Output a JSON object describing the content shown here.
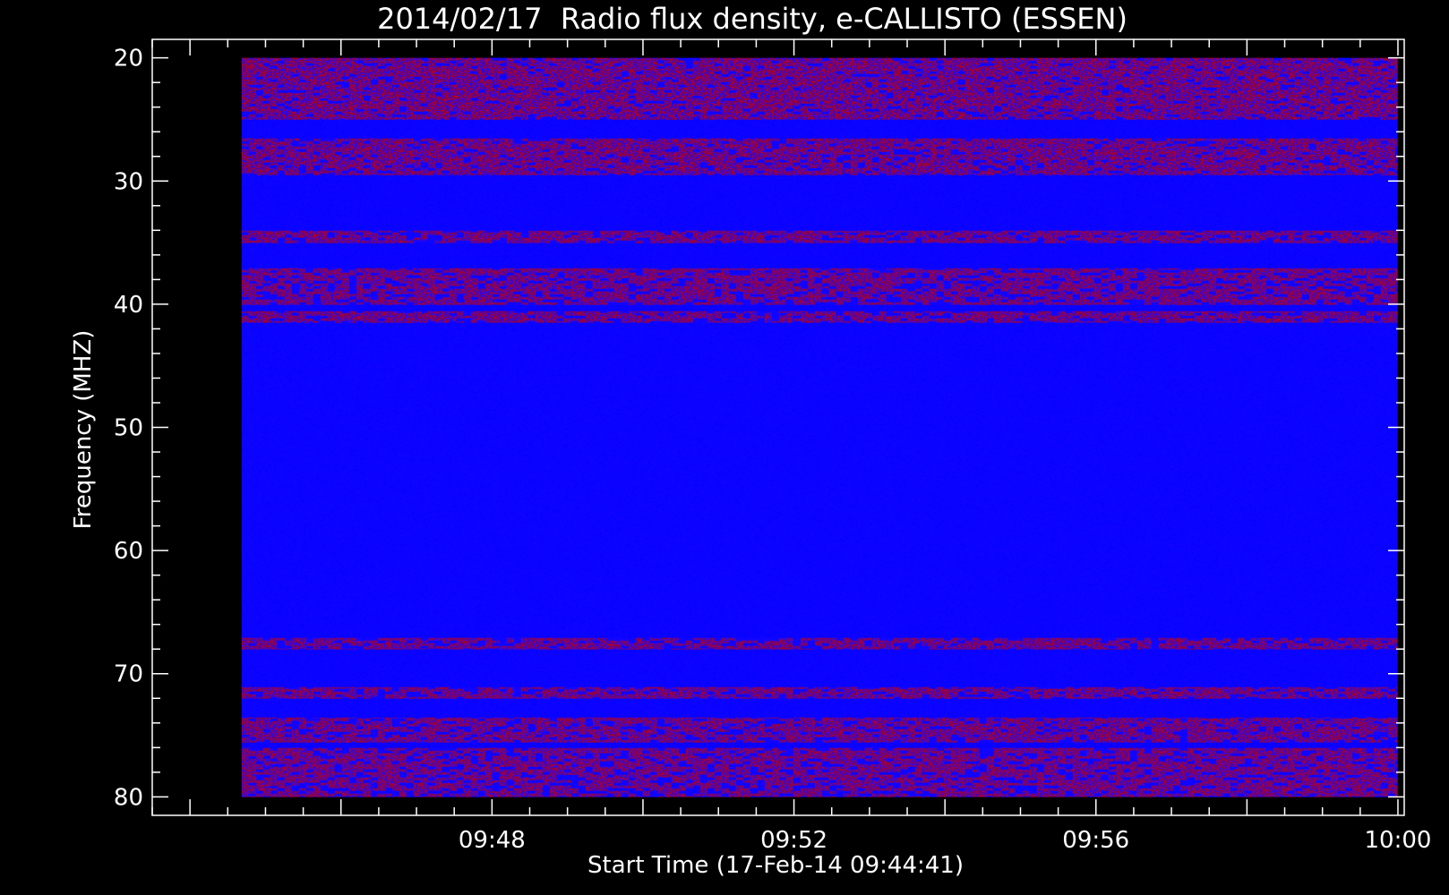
{
  "chart_data": {
    "type": "heatmap",
    "title": "2014/02/17  Radio flux density, e-CALLISTO (ESSEN)",
    "xlabel": "Start Time (17-Feb-14 09:44:41)",
    "ylabel": "Frequency (MHZ)",
    "x_unit": "UT time",
    "x_range": [
      "09:44:41",
      "10:00:00"
    ],
    "x_axis_range": [
      "09:43:30",
      "10:00:05"
    ],
    "x_ticks": [
      "09:48",
      "09:52",
      "09:56",
      "10:00"
    ],
    "y_unit": "MHz",
    "y_range": [
      20,
      80
    ],
    "y_axis_range": [
      18.5,
      81.5
    ],
    "y_inverted": true,
    "y_ticks": [
      20,
      30,
      40,
      50,
      60,
      70,
      80
    ],
    "colormap": [
      "#000000",
      "#0000ff",
      "#b00000",
      "#ff4000",
      "#ffd000",
      "#ffffff"
    ],
    "background_level": "blue",
    "emission_bands": [
      {
        "freq_range": [
          20,
          25
        ],
        "level": "high",
        "color": "red/yellow with dark gaps"
      },
      {
        "freq_range": [
          26.5,
          29.5
        ],
        "level": "medium-high",
        "color": "red/yellow"
      },
      {
        "freq_range": [
          34,
          35
        ],
        "level": "medium",
        "color": "red (mainly after 09:52)"
      },
      {
        "freq_range": [
          37,
          40
        ],
        "level": "low-medium",
        "color": "scattered red"
      },
      {
        "freq_range": [
          40.5,
          41.5
        ],
        "level": "medium",
        "color": "dashed red line"
      },
      {
        "freq_range": [
          67,
          68
        ],
        "level": "medium",
        "color": "dashed red, stronger near 10:00"
      },
      {
        "freq_range": [
          71,
          72
        ],
        "level": "medium",
        "color": "red/dark"
      },
      {
        "freq_range": [
          73.5,
          75.5
        ],
        "level": "medium",
        "color": "red, strongest near 10:00"
      },
      {
        "freq_range": [
          76,
          80
        ],
        "level": "low-medium",
        "color": "red speckles"
      }
    ]
  }
}
